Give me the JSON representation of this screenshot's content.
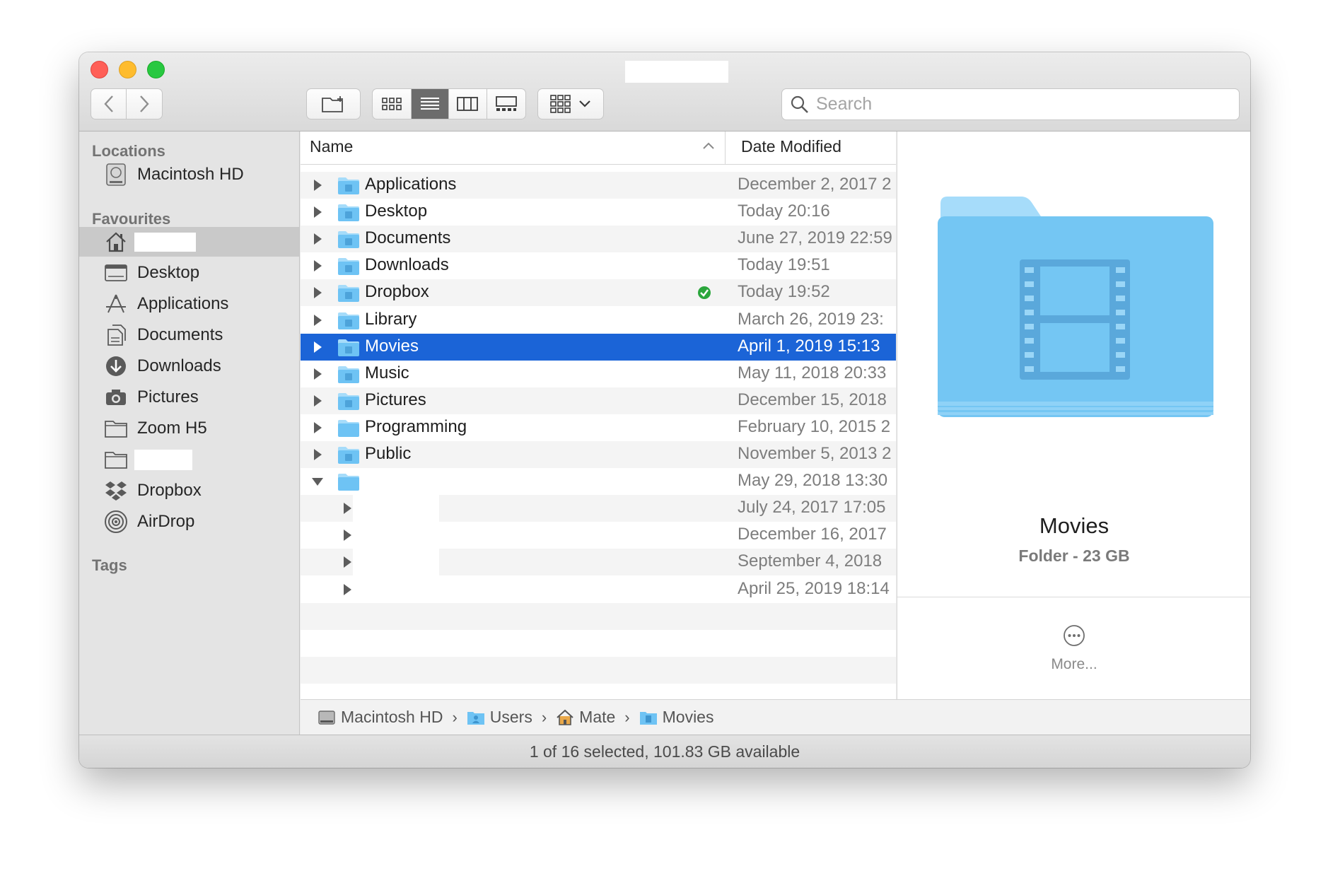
{
  "window": {
    "status": "1 of 16 selected, 101.83 GB available"
  },
  "toolbar": {
    "search_placeholder": "Search",
    "view_modes": [
      "icons",
      "list",
      "columns",
      "gallery"
    ],
    "active_view": "list"
  },
  "sidebar": {
    "locations_header": "Locations",
    "locations": [
      {
        "label": "Macintosh HD",
        "icon": "harddisk-icon"
      }
    ],
    "favourites_header": "Favourites",
    "favourites": [
      {
        "label": "",
        "icon": "home-icon",
        "selected": true
      },
      {
        "label": "Desktop",
        "icon": "desktop-icon"
      },
      {
        "label": "Applications",
        "icon": "applications-icon"
      },
      {
        "label": "Documents",
        "icon": "documents-icon"
      },
      {
        "label": "Downloads",
        "icon": "downloads-icon"
      },
      {
        "label": "Pictures",
        "icon": "camera-icon"
      },
      {
        "label": "Zoom H5",
        "icon": "folder-icon"
      },
      {
        "label": "",
        "icon": "folder-icon"
      },
      {
        "label": "Dropbox",
        "icon": "dropbox-icon"
      },
      {
        "label": "AirDrop",
        "icon": "airdrop-icon"
      }
    ],
    "tags_header": "Tags"
  },
  "list": {
    "col_name": "Name",
    "col_date": "Date Modified",
    "rows": [
      {
        "name": "Applications",
        "date": "December 2, 2017 2",
        "icon": "applications-folder-icon"
      },
      {
        "name": "Desktop",
        "date": "Today 20:16",
        "icon": "desktop-folder-icon"
      },
      {
        "name": "Documents",
        "date": "June 27, 2019 22:59",
        "icon": "documents-folder-icon"
      },
      {
        "name": "Downloads",
        "date": "Today 19:51",
        "icon": "downloads-folder-icon"
      },
      {
        "name": "Dropbox",
        "date": "Today 19:52",
        "icon": "dropbox-folder-icon",
        "synced": true
      },
      {
        "name": "Library",
        "date": "March 26, 2019 23:",
        "icon": "library-folder-icon"
      },
      {
        "name": "Movies",
        "date": "April 1, 2019 15:13",
        "icon": "movies-folder-icon",
        "selected": true
      },
      {
        "name": "Music",
        "date": "May 11, 2018 20:33",
        "icon": "music-folder-icon"
      },
      {
        "name": "Pictures",
        "date": "December 15, 2018",
        "icon": "pictures-folder-icon"
      },
      {
        "name": "Programming",
        "date": "February 10, 2015 2",
        "icon": "folder-icon"
      },
      {
        "name": "Public",
        "date": "November 5, 2013 2",
        "icon": "public-folder-icon"
      },
      {
        "name": "",
        "date": "May 29, 2018 13:30",
        "icon": "folder-icon",
        "expanded": true
      },
      {
        "name": "",
        "date": "July 24, 2017 17:05",
        "indent": true
      },
      {
        "name": "",
        "date": "December 16, 2017",
        "indent": true
      },
      {
        "name": "",
        "date": "September 4, 2018",
        "indent": true
      },
      {
        "name": "",
        "date": "April 25, 2019 18:14",
        "indent": true
      }
    ]
  },
  "preview": {
    "name": "Movies",
    "info": "Folder - 23 GB",
    "more": "More..."
  },
  "pathbar": {
    "crumbs": [
      {
        "label": "Macintosh HD",
        "icon": "harddisk-icon"
      },
      {
        "label": "Users",
        "icon": "users-folder-icon"
      },
      {
        "label": "Mate",
        "icon": "home-icon"
      },
      {
        "label": "Movies",
        "icon": "movies-folder-icon"
      }
    ]
  },
  "colors": {
    "selection": "#1b64d7",
    "folder": "#6ec3f4",
    "synced": "#2aa63c"
  }
}
